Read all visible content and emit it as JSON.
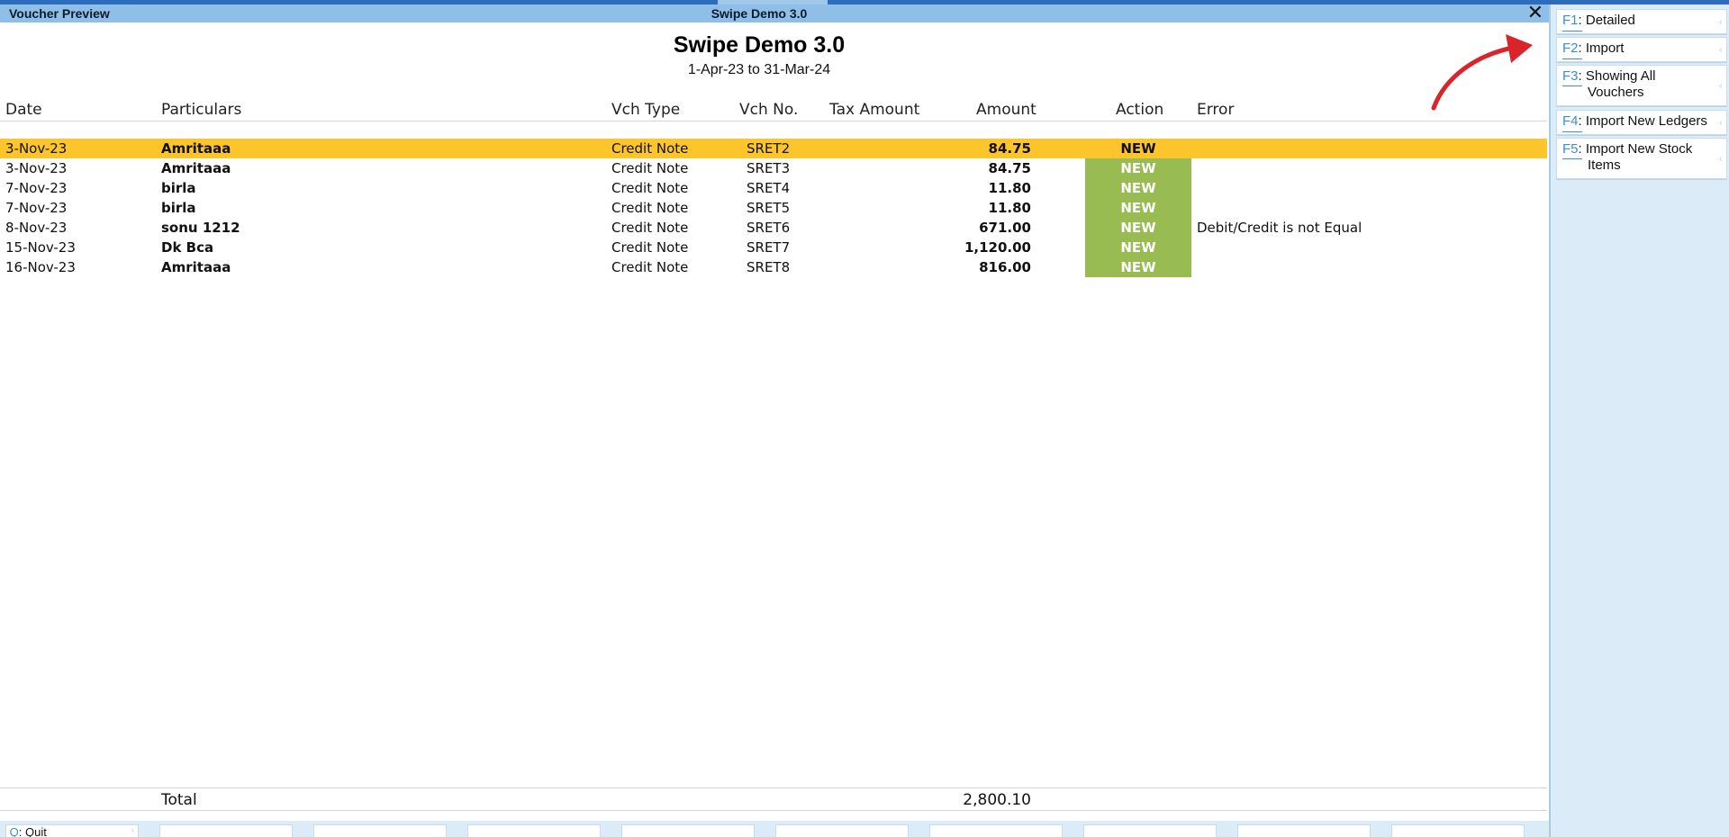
{
  "window": {
    "left_title": "Voucher Preview",
    "center_title": "Swipe Demo 3.0",
    "close_glyph": "✕"
  },
  "report": {
    "company": "Swipe Demo 3.0",
    "period": "1-Apr-23 to 31-Mar-24"
  },
  "columns": {
    "date": "Date",
    "particulars": "Particulars",
    "vch_type": "Vch Type",
    "vch_no": "Vch No.",
    "tax_amount": "Tax Amount",
    "amount": "Amount",
    "action": "Action",
    "error": "Error"
  },
  "rows": [
    {
      "date": "3-Nov-23",
      "particulars": "Amritaaa",
      "vch_type": "Credit Note",
      "vch_no": "SRET2",
      "tax_amount": "",
      "amount": "84.75",
      "action": "NEW",
      "error": ""
    },
    {
      "date": "3-Nov-23",
      "particulars": "Amritaaa",
      "vch_type": "Credit Note",
      "vch_no": "SRET3",
      "tax_amount": "",
      "amount": "84.75",
      "action": "NEW",
      "error": ""
    },
    {
      "date": "7-Nov-23",
      "particulars": "birla",
      "vch_type": "Credit Note",
      "vch_no": "SRET4",
      "tax_amount": "",
      "amount": "11.80",
      "action": "NEW",
      "error": ""
    },
    {
      "date": "7-Nov-23",
      "particulars": "birla",
      "vch_type": "Credit Note",
      "vch_no": "SRET5",
      "tax_amount": "",
      "amount": "11.80",
      "action": "NEW",
      "error": ""
    },
    {
      "date": "8-Nov-23",
      "particulars": "sonu 1212",
      "vch_type": "Credit Note",
      "vch_no": "SRET6",
      "tax_amount": "",
      "amount": "671.00",
      "action": "NEW",
      "error": "Debit/Credit is not Equal"
    },
    {
      "date": "15-Nov-23",
      "particulars": "Dk Bca",
      "vch_type": "Credit Note",
      "vch_no": "SRET7",
      "tax_amount": "",
      "amount": "1,120.00",
      "action": "NEW",
      "error": ""
    },
    {
      "date": "16-Nov-23",
      "particulars": "Amritaaa",
      "vch_type": "Credit Note",
      "vch_no": "SRET8",
      "tax_amount": "",
      "amount": "816.00",
      "action": "NEW",
      "error": ""
    }
  ],
  "total": {
    "label": "Total",
    "amount": "2,800.10"
  },
  "sidebar": {
    "items": [
      {
        "key": "F1",
        "label": "Detailed"
      },
      {
        "key": "F2",
        "label": "Import"
      },
      {
        "key": "F3",
        "label": "Showing All",
        "label2": "Vouchers"
      },
      {
        "key": "F4",
        "label": "Import New Ledgers"
      },
      {
        "key": "F5",
        "label": "Import New Stock",
        "label2": "Items"
      }
    ]
  },
  "bottom": {
    "quit_key": "Q",
    "quit_label": "Quit"
  },
  "colors": {
    "selected_row": "#fcc52c",
    "action_new_bg": "#98bc52",
    "titlebar": "#8fbfe6",
    "sidebar_bg": "#dcebf8",
    "annotation_arrow": "#d9252a"
  },
  "icons": {
    "close": "close-icon",
    "chevron": "chevron-left-icon",
    "annotation": "red-arrow-annotation"
  }
}
